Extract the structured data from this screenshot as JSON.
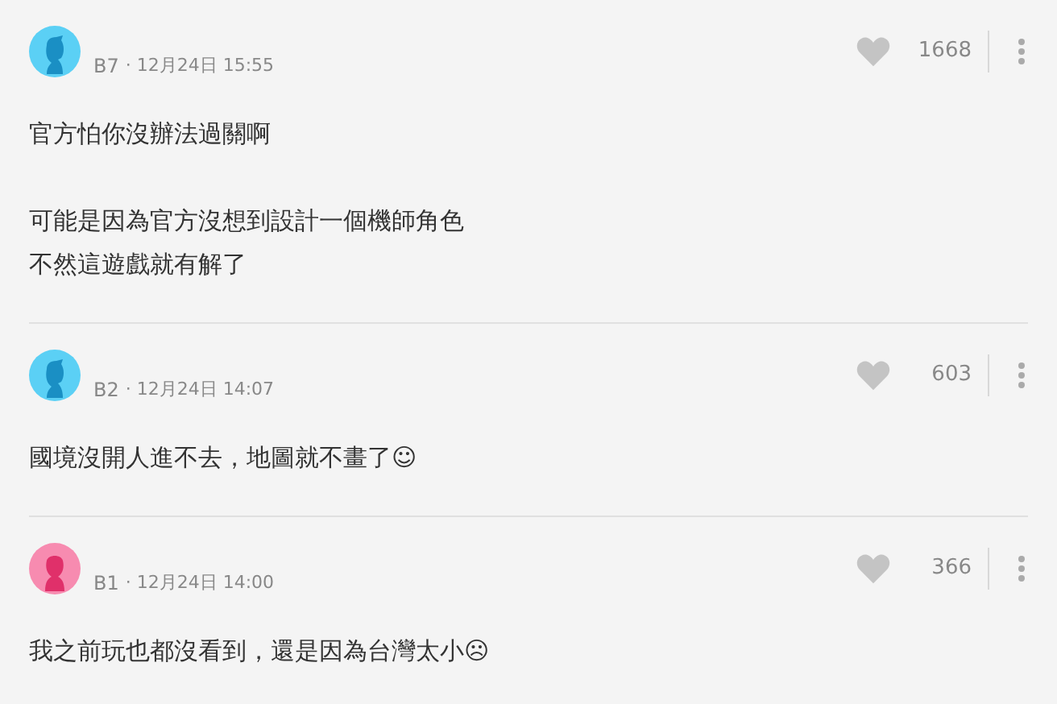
{
  "comments": [
    {
      "kind": "male",
      "floor": "B7",
      "time": "· 12月24日 15:55",
      "likes": "1668",
      "paragraphs": [
        [
          "官方怕你沒辦法過關啊"
        ],
        [
          "可能是因為官方沒想到設計一個機師角色",
          "不然這遊戲就有解了"
        ]
      ]
    },
    {
      "kind": "male",
      "floor": "B2",
      "time": "· 12月24日 14:07",
      "likes": "603",
      "paragraphs": [
        [
          "國境沒開人進不去，地圖就不畫了☺"
        ]
      ]
    },
    {
      "kind": "female",
      "floor": "B1",
      "time": "· 12月24日 14:00",
      "likes": "366",
      "paragraphs": [
        [
          "我之前玩也都沒看到，還是因為台灣太小☹"
        ]
      ]
    }
  ]
}
